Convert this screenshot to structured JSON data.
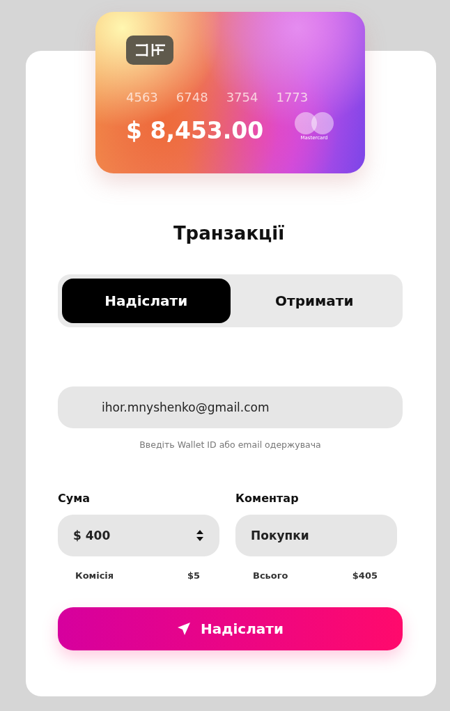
{
  "card": {
    "number_groups": [
      "4563",
      "6748",
      "3754",
      "1773"
    ],
    "balance": "$ 8,453.00",
    "brand": "Mastercard"
  },
  "title": "Транзакції",
  "tabs": [
    {
      "label": "Надіслати",
      "selected": true
    },
    {
      "label": "Отримати",
      "selected": false
    }
  ],
  "recipient": {
    "value": "ihor.mnyshenko@gmail.com",
    "hint": "Введіть Wallet ID або email одержувача"
  },
  "amount": {
    "label": "Сума",
    "value": "$ 400"
  },
  "comment": {
    "label": "Коментар",
    "value": "Покупки"
  },
  "fee": {
    "label": "Комісія",
    "value": "$5"
  },
  "total": {
    "label": "Всього",
    "value": "$405"
  },
  "submit": {
    "label": "Надіслати"
  }
}
